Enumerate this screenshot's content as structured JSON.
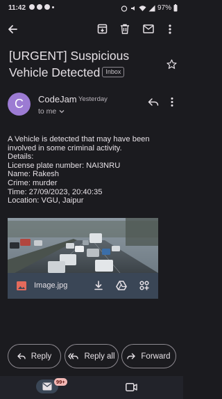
{
  "status_bar": {
    "time": "11:42",
    "battery": "97%"
  },
  "email": {
    "subject": "[URGENT] Suspicious Vehicle Detected",
    "label": "Inbox",
    "sender": {
      "initial": "C",
      "name": "CodeJam",
      "time": "Yesterday",
      "recipient": "to me"
    },
    "body_lines": [
      "A Vehicle is detected that may have been",
      "involved in some criminal activity.",
      "Details:",
      "License plate number: NAI3NRU",
      "Name: Rakesh",
      "Crime: murder",
      "Time: 27/09/2023, 20:40:35",
      "Location: VGU, Jaipur"
    ],
    "attachment": {
      "name": "Image.jpg"
    }
  },
  "actions": {
    "reply": "Reply",
    "reply_all": "Reply all",
    "forward": "Forward"
  },
  "bottom_nav": {
    "mail_badge": "99+"
  },
  "colors": {
    "background": "#1b1b1f",
    "avatar": "#9c7bd3",
    "attachment_bar": "#3a4656",
    "badge": "#f2b8b5"
  }
}
